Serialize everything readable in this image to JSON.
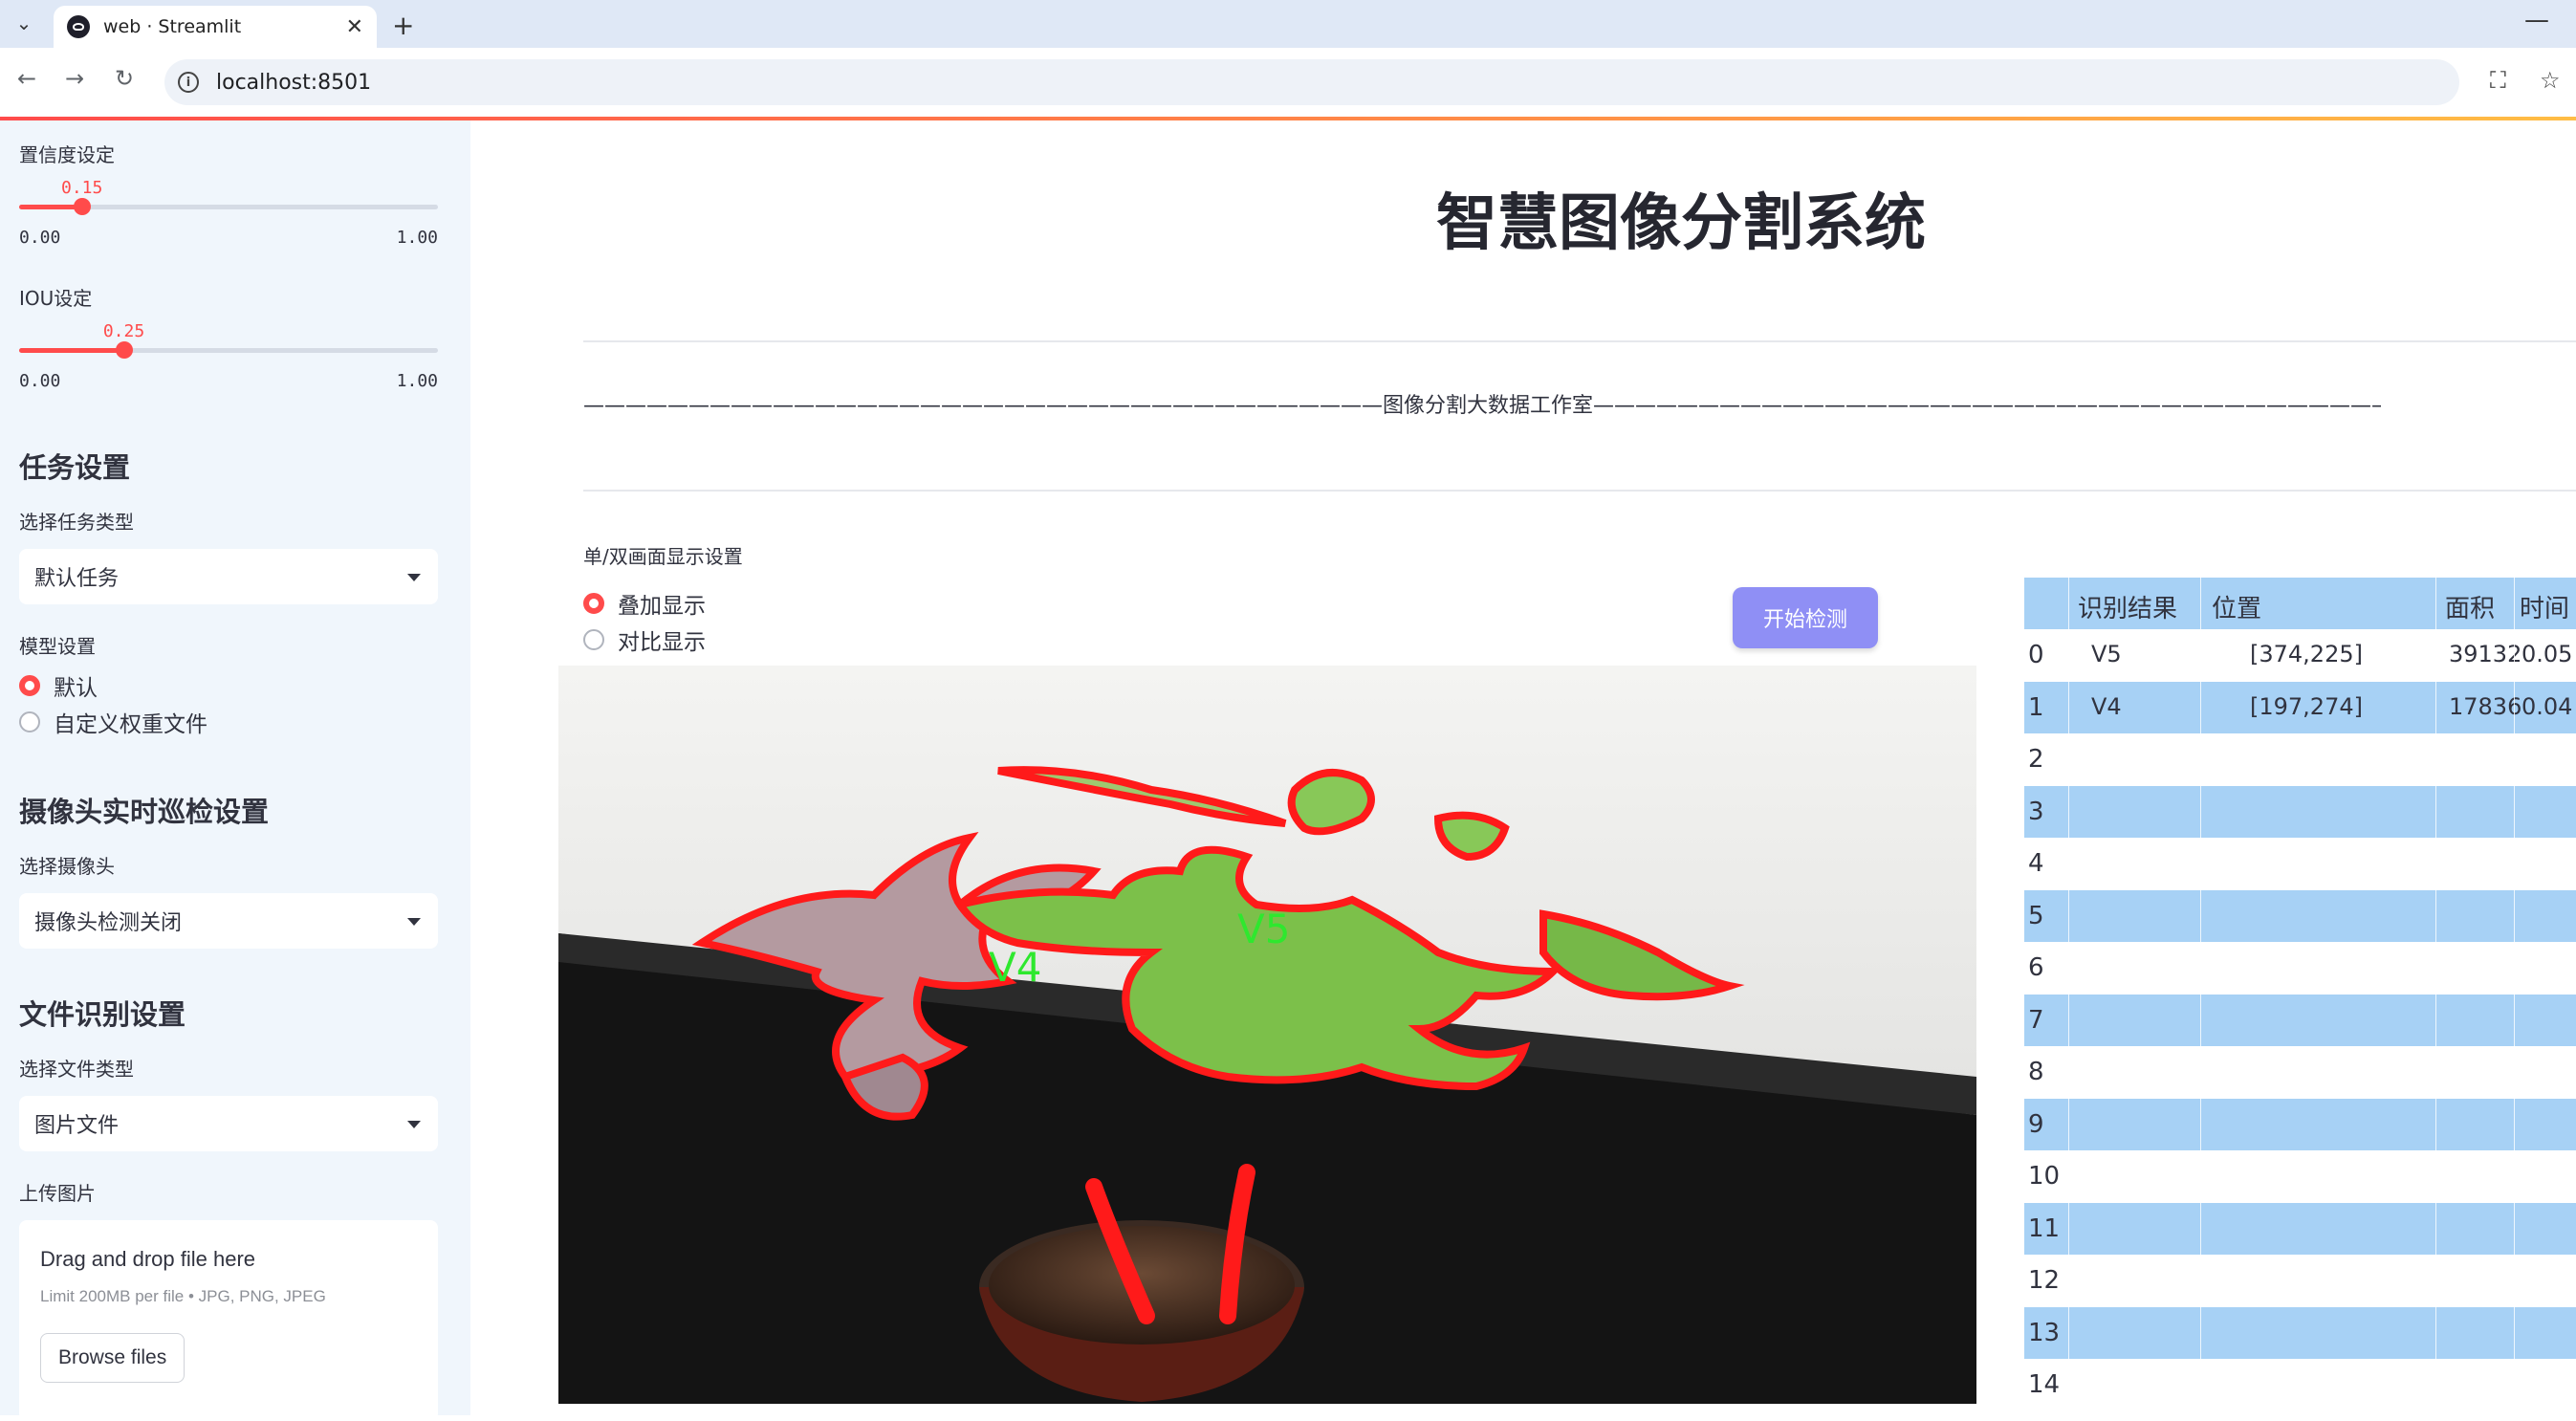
{
  "browser": {
    "tab_title": "web · Streamlit",
    "url": "localhost:8501"
  },
  "sidebar": {
    "confidence": {
      "label": "置信度设定",
      "value": "0.15",
      "value_num": 0.15,
      "min": "0.00",
      "max": "1.00"
    },
    "iou": {
      "label": "IOU设定",
      "value": "0.25",
      "value_num": 0.25,
      "min": "0.00",
      "max": "1.00"
    },
    "task_heading": "任务设置",
    "task_type_label": "选择任务类型",
    "task_type_value": "默认任务",
    "model_label": "模型设置",
    "model_options": [
      "默认",
      "自定义权重文件"
    ],
    "model_selected": "默认",
    "camera_heading": "摄像头实时巡检设置",
    "camera_label": "选择摄像头",
    "camera_value": "摄像头检测关闭",
    "file_heading": "文件识别设置",
    "file_type_label": "选择文件类型",
    "file_type_value": "图片文件",
    "upload_label": "上传图片",
    "uploader": {
      "drag_text": "Drag and drop file here",
      "limit_text": "Limit 200MB per file • JPG, PNG, JPEG",
      "browse_label": "Browse files"
    }
  },
  "main": {
    "title": "智慧图像分割系统",
    "subtitle": "——————————————————————————————————————图像分割大数据工作室——————————————————————————————————————",
    "display_label": "单/双画面显示设置",
    "display_options": [
      "叠加显示",
      "对比显示"
    ],
    "display_selected": "叠加显示",
    "start_button": "开始检测",
    "image_labels": [
      "V4",
      "V5"
    ]
  },
  "table": {
    "columns": [
      "识别结果",
      "位置",
      "面积",
      "时间"
    ],
    "rows": [
      {
        "index": "0",
        "result": "V5",
        "position": "[374,225]",
        "area": "39132",
        "time": "0.05"
      },
      {
        "index": "1",
        "result": "V4",
        "position": "[197,274]",
        "area": "17836",
        "time": "0.04"
      },
      {
        "index": "2",
        "result": "",
        "position": "",
        "area": "",
        "time": ""
      },
      {
        "index": "3",
        "result": "",
        "position": "",
        "area": "",
        "time": ""
      },
      {
        "index": "4",
        "result": "",
        "position": "",
        "area": "",
        "time": ""
      },
      {
        "index": "5",
        "result": "",
        "position": "",
        "area": "",
        "time": ""
      },
      {
        "index": "6",
        "result": "",
        "position": "",
        "area": "",
        "time": ""
      },
      {
        "index": "7",
        "result": "",
        "position": "",
        "area": "",
        "time": ""
      },
      {
        "index": "8",
        "result": "",
        "position": "",
        "area": "",
        "time": ""
      },
      {
        "index": "9",
        "result": "",
        "position": "",
        "area": "",
        "time": ""
      },
      {
        "index": "10",
        "result": "",
        "position": "",
        "area": "",
        "time": ""
      },
      {
        "index": "11",
        "result": "",
        "position": "",
        "area": "",
        "time": ""
      },
      {
        "index": "12",
        "result": "",
        "position": "",
        "area": "",
        "time": ""
      },
      {
        "index": "13",
        "result": "",
        "position": "",
        "area": "",
        "time": ""
      },
      {
        "index": "14",
        "result": "",
        "position": "",
        "area": "",
        "time": ""
      }
    ]
  }
}
